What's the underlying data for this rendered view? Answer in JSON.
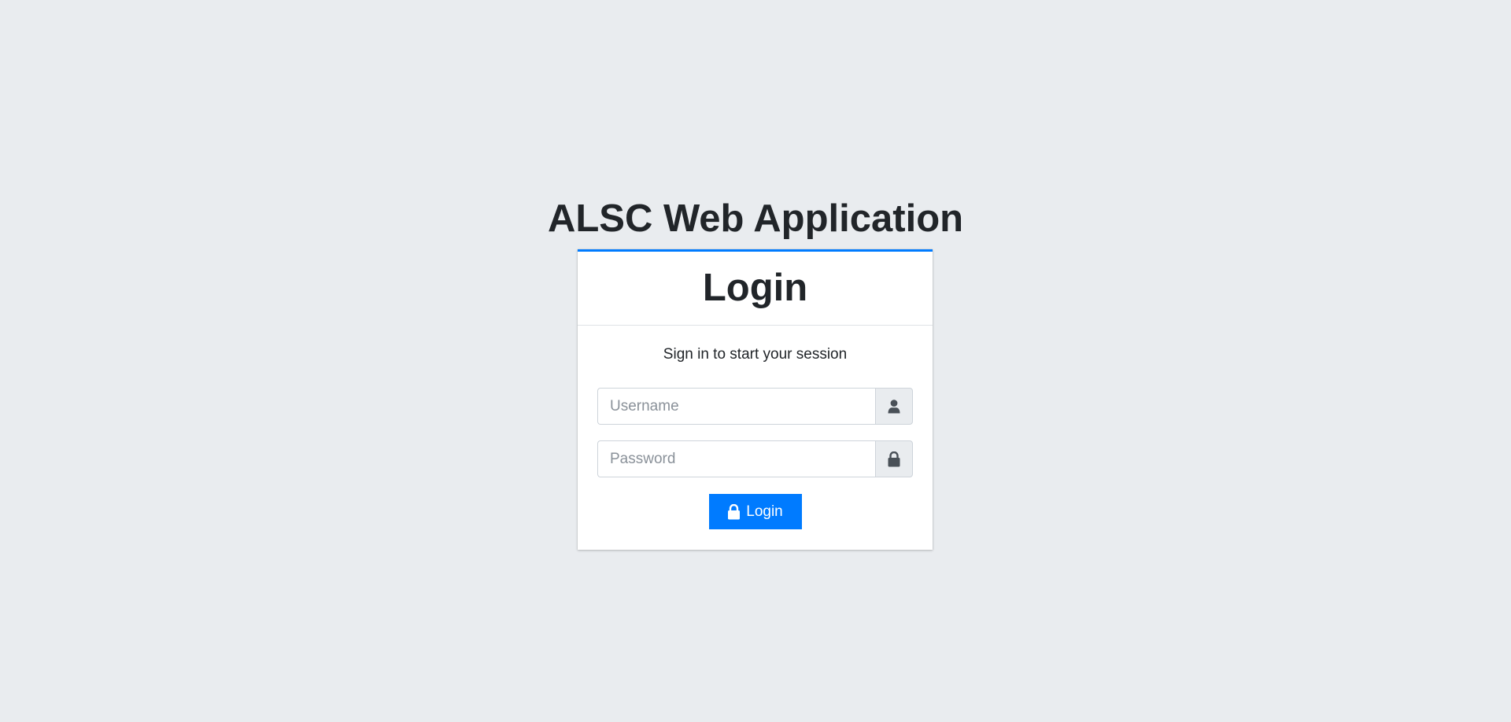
{
  "app": {
    "title": "ALSC Web Application"
  },
  "login_card": {
    "header": "Login",
    "message": "Sign in to start your session",
    "username": {
      "placeholder": "Username",
      "value": "",
      "icon": "user-icon"
    },
    "password": {
      "placeholder": "Password",
      "value": "",
      "icon": "lock-icon"
    },
    "submit_label": "Login",
    "submit_icon": "lock-icon"
  },
  "colors": {
    "background": "#e9ecef",
    "accent": "#007bff",
    "card": "#ffffff",
    "text": "#212529",
    "addon": "#e9ecef",
    "icon": "#495057"
  }
}
